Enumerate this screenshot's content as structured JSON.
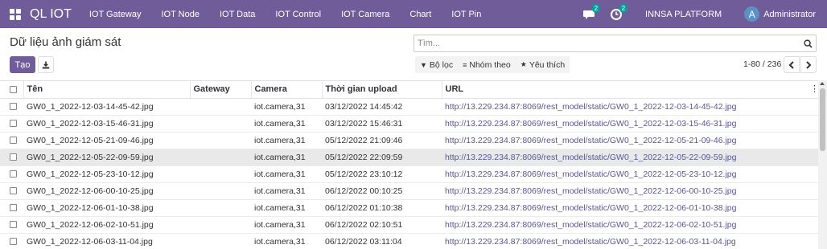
{
  "navbar": {
    "brand": "QL IOT",
    "menu": [
      "IOT Gateway",
      "IOT Node",
      "IOT Data",
      "IOT Control",
      "IOT Camera",
      "Chart",
      "IOT Pin"
    ],
    "messages_badge": "2",
    "activity_badge": "2",
    "company": "INNSA PLATFORM",
    "user_initial": "A",
    "user_name": "Administrator"
  },
  "control": {
    "title": "Dữ liệu ảnh giám sát",
    "search_placeholder": "Tìm...",
    "create_label": "Tạo",
    "filter_label": "Bộ lọc",
    "group_label": "Nhóm theo",
    "favorite_label": "Yêu thích",
    "pager_value": "1-80 / 236"
  },
  "table": {
    "columns": [
      "Tên",
      "Gateway",
      "Camera",
      "Thời gian upload",
      "URL"
    ],
    "rows": [
      {
        "name": "GW0_1_2022-12-03-14-45-42.jpg",
        "gateway": "",
        "camera": "iot.camera,31",
        "time": "03/12/2022 14:45:42",
        "url": "http://13.229.234.87:8069/rest_model/static/GW0_1_2022-12-03-14-45-42.jpg"
      },
      {
        "name": "GW0_1_2022-12-03-15-46-31.jpg",
        "gateway": "",
        "camera": "iot.camera,31",
        "time": "03/12/2022 15:46:31",
        "url": "http://13.229.234.87:8069/rest_model/static/GW0_1_2022-12-03-15-46-31.jpg"
      },
      {
        "name": "GW0_1_2022-12-05-21-09-46.jpg",
        "gateway": "",
        "camera": "iot.camera,31",
        "time": "05/12/2022 21:09:46",
        "url": "http://13.229.234.87:8069/rest_model/static/GW0_1_2022-12-05-21-09-46.jpg"
      },
      {
        "name": "GW0_1_2022-12-05-22-09-59.jpg",
        "gateway": "",
        "camera": "iot.camera,31",
        "time": "05/12/2022 22:09:59",
        "url": "http://13.229.234.87:8069/rest_model/static/GW0_1_2022-12-05-22-09-59.jpg"
      },
      {
        "name": "GW0_1_2022-12-05-23-10-12.jpg",
        "gateway": "",
        "camera": "iot.camera,31",
        "time": "05/12/2022 23:10:12",
        "url": "http://13.229.234.87:8069/rest_model/static/GW0_1_2022-12-05-23-10-12.jpg"
      },
      {
        "name": "GW0_1_2022-12-06-00-10-25.jpg",
        "gateway": "",
        "camera": "iot.camera,31",
        "time": "06/12/2022 00:10:25",
        "url": "http://13.229.234.87:8069/rest_model/static/GW0_1_2022-12-06-00-10-25.jpg"
      },
      {
        "name": "GW0_1_2022-12-06-01-10-38.jpg",
        "gateway": "",
        "camera": "iot.camera,31",
        "time": "06/12/2022 01:10:38",
        "url": "http://13.229.234.87:8069/rest_model/static/GW0_1_2022-12-06-01-10-38.jpg"
      },
      {
        "name": "GW0_1_2022-12-06-02-10-51.jpg",
        "gateway": "",
        "camera": "iot.camera,31",
        "time": "06/12/2022 02:10:51",
        "url": "http://13.229.234.87:8069/rest_model/static/GW0_1_2022-12-06-02-10-51.jpg"
      },
      {
        "name": "GW0_1_2022-12-06-03-11-04.jpg",
        "gateway": "",
        "camera": "iot.camera,31",
        "time": "06/12/2022 03:11:04",
        "url": "http://13.229.234.87:8069/rest_model/static/GW0_1_2022-12-06-03-11-04.jpg"
      }
    ]
  },
  "colors": {
    "navbar": "#6f5c98",
    "badge": "#00a09d",
    "link": "#5b5590",
    "highlight_row": "#e9e9e9"
  },
  "icons": {
    "apps": "apps-grid-icon",
    "messages": "chat-bubble-icon",
    "activity": "clock-icon",
    "search": "search-icon",
    "download": "download-icon",
    "filter": "filter-icon",
    "group": "list-icon",
    "favorite": "star-icon",
    "optional_columns": "vertical-dots-icon"
  }
}
